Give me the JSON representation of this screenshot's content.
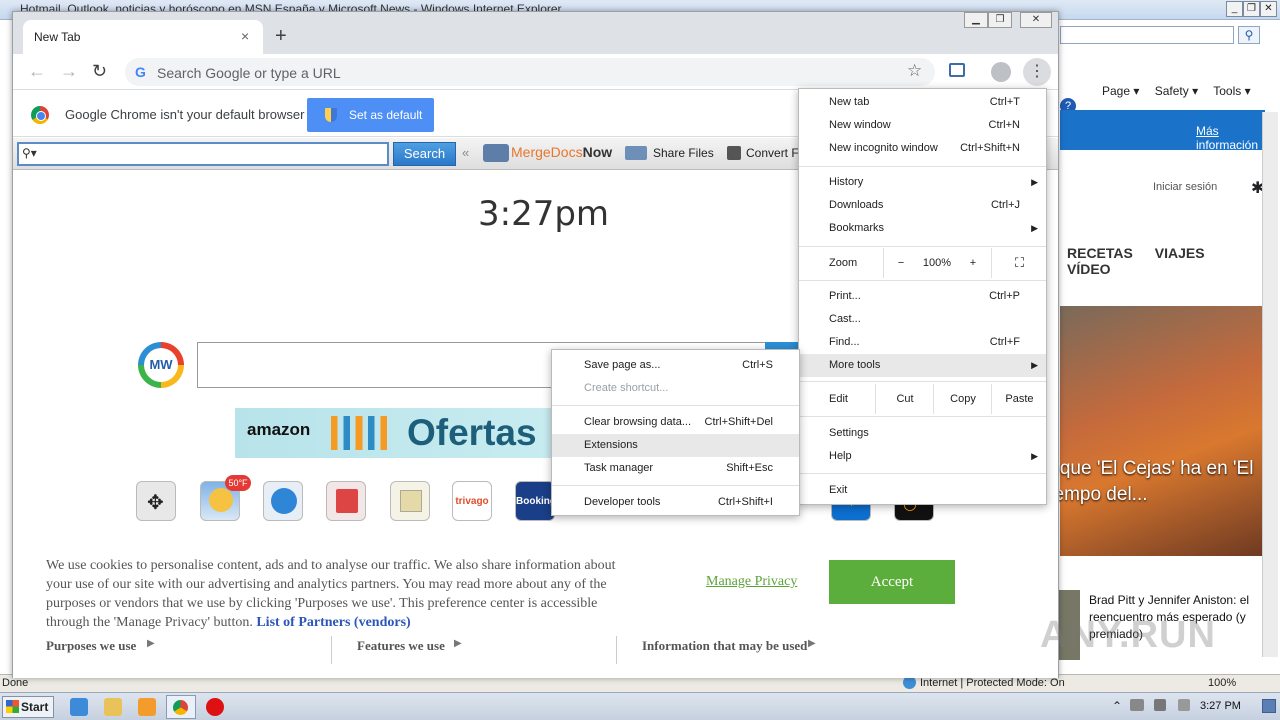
{
  "ie": {
    "title": "Hotmail, Outlook, noticias y horóscopo en MSN España y Microsoft News - Windows Internet Explorer",
    "commands": [
      "Page ▾",
      "Safety ▾",
      "Tools ▾",
      "?"
    ],
    "mas_info": "Más información",
    "login": "Iniciar sesión",
    "nav": [
      "RECETAS",
      "VIAJES",
      "VÍDEO"
    ],
    "photo_caption": "a que 'El Cejas' ha en 'El tiempo del...",
    "news2": "Brad Pitt y Jennifer Aniston: el reencuentro más esperado (y premiado)",
    "status_left": "Done",
    "status_zone": "Internet | Protected Mode: On",
    "status_zoom": "100%"
  },
  "taskbar": {
    "start": "Start",
    "clock": "3:27 PM"
  },
  "chrome": {
    "tab_title": "New Tab",
    "tab_close": "×",
    "new_tab": "+",
    "back": "←",
    "forward": "→",
    "reload": "↻",
    "omnibox_placeholder": "Search Google or type a URL",
    "menu_dots": "⋮",
    "infobar_text": "Google Chrome isn't your default browser",
    "set_default_label": "Set as default"
  },
  "mindspark": {
    "search_label": "Search",
    "mergedocs_a": "MergeDocs",
    "mergedocs_b": "Now",
    "share_files": "Share Files",
    "convert": "Convert F",
    "clock": "3:27pm",
    "mw_logo": "MW",
    "amazon": "amazon",
    "ofertas": "Ofertas",
    "weather_badge": "50°F",
    "trivago": "trivago",
    "booking": "Booking"
  },
  "cookie": {
    "text": "We use cookies to personalise content, ads and to analyse our traffic. We also share information about your use of our site with our advertising and analytics partners. You may read more about any of the purposes or vendors that we use by clicking 'Purposes we use'. This preference center is accessible through the 'Manage Privacy' button.",
    "partners": "List of Partners (vendors)",
    "manage_privacy": "Manage Privacy",
    "accept": "Accept",
    "purposes": "Purposes we use",
    "features": "Features we use",
    "information": "Information that may be used"
  },
  "menu": {
    "new_tab": "New tab",
    "new_tab_sc": "Ctrl+T",
    "new_window": "New window",
    "new_window_sc": "Ctrl+N",
    "incognito": "New incognito window",
    "incognito_sc": "Ctrl+Shift+N",
    "history": "History",
    "downloads": "Downloads",
    "downloads_sc": "Ctrl+J",
    "bookmarks": "Bookmarks",
    "zoom": "Zoom",
    "zoom_minus": "−",
    "zoom_value": "100%",
    "zoom_plus": "+",
    "print": "Print...",
    "print_sc": "Ctrl+P",
    "cast": "Cast...",
    "find": "Find...",
    "find_sc": "Ctrl+F",
    "more_tools": "More tools",
    "edit": "Edit",
    "cut": "Cut",
    "copy": "Copy",
    "paste": "Paste",
    "settings": "Settings",
    "help": "Help",
    "exit": "Exit"
  },
  "submenu": {
    "save_page": "Save page as...",
    "save_page_sc": "Ctrl+S",
    "create_shortcut": "Create shortcut...",
    "clear_browsing": "Clear browsing data...",
    "clear_browsing_sc": "Ctrl+Shift+Del",
    "extensions": "Extensions",
    "task_manager": "Task manager",
    "task_manager_sc": "Shift+Esc",
    "dev_tools": "Developer tools",
    "dev_tools_sc": "Ctrl+Shift+I"
  },
  "watermark": "ANY.RUN"
}
